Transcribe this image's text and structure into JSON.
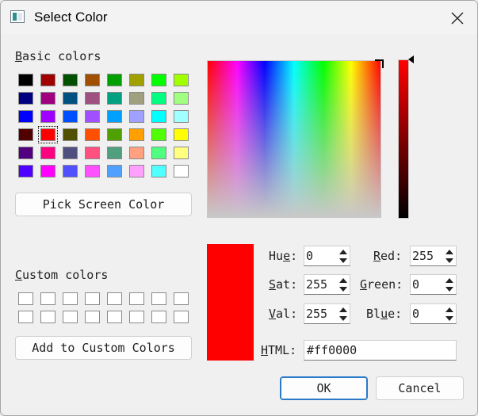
{
  "window": {
    "title": "Select Color"
  },
  "basic_colors": {
    "label": "Basic colors",
    "swatches": [
      [
        "#000000",
        "#a00000",
        "#005000",
        "#a05000",
        "#00a000",
        "#a0a000",
        "#00ff00",
        "#a0ff00"
      ],
      [
        "#000080",
        "#a00080",
        "#005080",
        "#a05080",
        "#00a080",
        "#a0a080",
        "#00ff80",
        "#a0ff80"
      ],
      [
        "#0000ff",
        "#a000ff",
        "#0050ff",
        "#a050ff",
        "#00a0ff",
        "#a0a0ff",
        "#00ffff",
        "#a0ffff"
      ],
      [
        "#500000",
        "#ff0000",
        "#505000",
        "#ff5000",
        "#50a000",
        "#ffa000",
        "#50ff00",
        "#ffff00"
      ],
      [
        "#500080",
        "#ff0080",
        "#505080",
        "#ff5080",
        "#50a080",
        "#ffa080",
        "#50ff80",
        "#ffff80"
      ],
      [
        "#5000ff",
        "#ff00ff",
        "#5050ff",
        "#ff50ff",
        "#50a0ff",
        "#ffa0ff",
        "#50ffff",
        "#ffffff"
      ]
    ],
    "selected": [
      3,
      1
    ]
  },
  "pick_screen_label": "Pick Screen Color",
  "custom_colors": {
    "label": "Custom colors",
    "rows": 2,
    "cols": 8
  },
  "add_custom_label": "Add to Custom Colors",
  "fields": {
    "hue": {
      "label": "Hue:",
      "value": "0"
    },
    "sat": {
      "label": "Sat:",
      "value": "255"
    },
    "val": {
      "label": "Val:",
      "value": "255"
    },
    "red": {
      "label": "Red:",
      "value": "255"
    },
    "green": {
      "label": "Green:",
      "value": "0"
    },
    "blue": {
      "label": "Blue:",
      "value": "0"
    },
    "html": {
      "label": "HTML:",
      "value": "#ff0000"
    }
  },
  "current_color": "#ff0000",
  "ok_label": "OK",
  "cancel_label": "Cancel",
  "icons": {
    "close": "close-icon",
    "app": "color-dialog-icon"
  }
}
